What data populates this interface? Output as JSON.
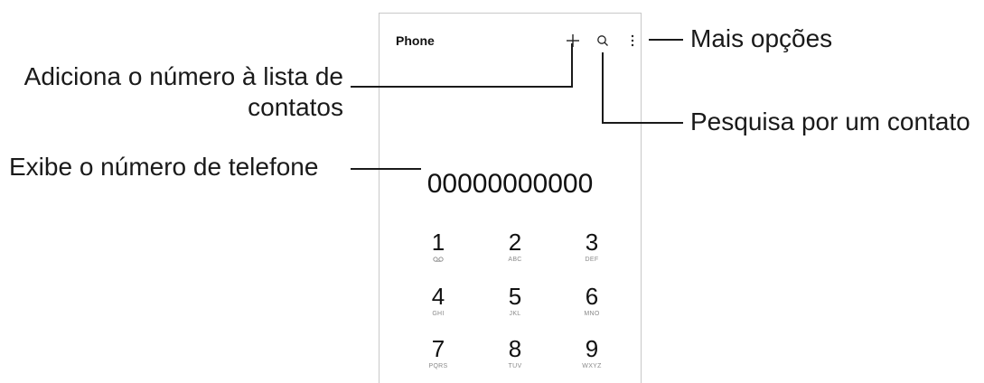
{
  "app_bar": {
    "title": "Phone",
    "icons": [
      "add-icon",
      "search-icon",
      "more-options-icon"
    ]
  },
  "display": {
    "number": "00000000000"
  },
  "keypad": [
    {
      "digit": "1",
      "letters": ""
    },
    {
      "digit": "2",
      "letters": "ABC"
    },
    {
      "digit": "3",
      "letters": "DEF"
    },
    {
      "digit": "4",
      "letters": "GHI"
    },
    {
      "digit": "5",
      "letters": "JKL"
    },
    {
      "digit": "6",
      "letters": "MNO"
    },
    {
      "digit": "7",
      "letters": "PQRS"
    },
    {
      "digit": "8",
      "letters": "TUV"
    },
    {
      "digit": "9",
      "letters": "WXYZ"
    }
  ],
  "callouts": {
    "add_line1": "Adiciona o número à lista de",
    "add_line2": "contatos",
    "display": "Exibe o número de telefone",
    "more": "Mais opções",
    "search": "Pesquisa por um contato"
  }
}
